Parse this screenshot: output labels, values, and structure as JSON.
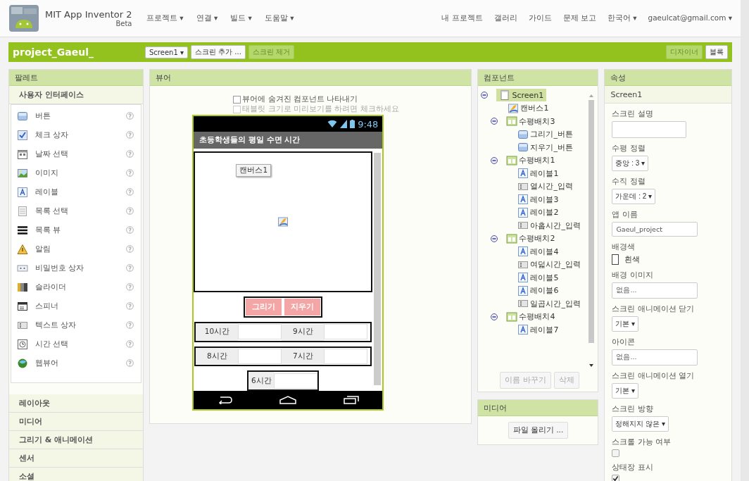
{
  "header": {
    "logo_title": "MIT App Inventor 2",
    "logo_subtitle": "Beta",
    "menus": [
      "프로젝트 ▾",
      "연결 ▾",
      "빌드 ▾",
      "도움말 ▾"
    ],
    "links": [
      "내 프로젝트",
      "갤러리",
      "가이드",
      "문제 보고",
      "한국어 ▾",
      "gaeulcat@gmail.com ▾"
    ]
  },
  "project_bar": {
    "name": "project_Gaeul_",
    "buttons": [
      {
        "label": "Screen1 ▾",
        "disabled": false
      },
      {
        "label": "스크린 추가 ...",
        "disabled": false
      },
      {
        "label": "스크린 제거",
        "disabled": true
      }
    ],
    "mode_buttons": [
      {
        "label": "디자이너",
        "selected": true
      },
      {
        "label": "블록",
        "selected": false
      }
    ]
  },
  "palette": {
    "title": "팔레트",
    "categories": [
      {
        "label": "사용자 인터페이스",
        "items": [
          {
            "kind": "button",
            "label": "버튼"
          },
          {
            "kind": "checkbox",
            "label": "체크 상자"
          },
          {
            "kind": "datepicker",
            "label": "날짜 선택"
          },
          {
            "kind": "image",
            "label": "이미지"
          },
          {
            "kind": "label",
            "label": "레이블"
          },
          {
            "kind": "listpicker",
            "label": "목록 선택"
          },
          {
            "kind": "listview",
            "label": "목록 뷰"
          },
          {
            "kind": "notifier",
            "label": "알림"
          },
          {
            "kind": "password",
            "label": "비밀번호 상자"
          },
          {
            "kind": "slider",
            "label": "슬라이더"
          },
          {
            "kind": "spinner",
            "label": "스피너"
          },
          {
            "kind": "textbox",
            "label": "텍스트 상자"
          },
          {
            "kind": "timepicker",
            "label": "시간 선택"
          },
          {
            "kind": "webviewer",
            "label": "웹뷰어"
          }
        ]
      },
      {
        "label": "레이아웃"
      },
      {
        "label": "미디어"
      },
      {
        "label": "그리기 & 애니메이션"
      },
      {
        "label": "센서"
      },
      {
        "label": "소셜"
      }
    ]
  },
  "viewer": {
    "title": "뷰어",
    "options": [
      {
        "label": "뷰어에 숨겨진 컴포넌트 나타내기",
        "checked": false,
        "disabled": false
      },
      {
        "label": "태블릿 크기로 미리보기를 하려면 체크하세요",
        "checked": false,
        "disabled": true
      }
    ],
    "phone": {
      "time": "9:48",
      "title": "초등학생들의 평일 수면 시간",
      "canvas_label": "캔버스1",
      "buttons": [
        "그리기",
        "지우기"
      ],
      "rows": [
        {
          "fields": [
            {
              "label": "10시간"
            },
            {
              "label": "9시간"
            }
          ]
        },
        {
          "fields": [
            {
              "label": "8시간"
            },
            {
              "label": "7시간"
            }
          ]
        },
        {
          "fields": [
            {
              "label": "6시간"
            }
          ]
        }
      ]
    }
  },
  "components": {
    "title": "컴포넌트",
    "tree": [
      {
        "kind": "screen",
        "label": "Screen1",
        "selected": true,
        "expanded": true,
        "children": [
          {
            "kind": "canvas",
            "label": "캔버스1",
            "selected": false
          },
          {
            "kind": "arrangement",
            "label": "수평배치3",
            "selected": false,
            "expanded": true,
            "children": [
              {
                "kind": "button",
                "label": "그리기_버튼",
                "selected": false
              },
              {
                "kind": "button",
                "label": "지우기_버튼",
                "selected": false
              }
            ]
          },
          {
            "kind": "arrangement",
            "label": "수평배치1",
            "selected": false,
            "expanded": true,
            "children": [
              {
                "kind": "label",
                "label": "레이블1",
                "selected": false
              },
              {
                "kind": "textbox",
                "label": "열시간_입력",
                "selected": false
              },
              {
                "kind": "label",
                "label": "레이블3",
                "selected": false
              },
              {
                "kind": "label",
                "label": "레이블2",
                "selected": false
              },
              {
                "kind": "textbox",
                "label": "아홉시간_입력",
                "selected": false
              }
            ]
          },
          {
            "kind": "arrangement",
            "label": "수평배치2",
            "selected": false,
            "expanded": true,
            "children": [
              {
                "kind": "label",
                "label": "레이블4",
                "selected": false
              },
              {
                "kind": "textbox",
                "label": "여덟시간_입력",
                "selected": false
              },
              {
                "kind": "label",
                "label": "레이블5",
                "selected": false
              },
              {
                "kind": "label",
                "label": "레이블6",
                "selected": false
              },
              {
                "kind": "textbox",
                "label": "일곱시간_입력",
                "selected": false
              }
            ]
          },
          {
            "kind": "arrangement",
            "label": "수평배치4",
            "selected": false,
            "expanded": true,
            "children": [
              {
                "kind": "label",
                "label": "레이블7",
                "selected": false
              }
            ]
          }
        ]
      }
    ],
    "buttons": [
      {
        "label": "이름 바꾸기",
        "disabled": true
      },
      {
        "label": "삭제",
        "disabled": true
      }
    ]
  },
  "media": {
    "title": "미디어",
    "button": "파일 올리기 ..."
  },
  "properties": {
    "title": "속성",
    "component": "Screen1",
    "items": [
      {
        "kind": "textarea",
        "label": "스크린 설명"
      },
      {
        "kind": "select",
        "label": "수평 정렬",
        "value": "중앙 : 3 ▾"
      },
      {
        "kind": "select",
        "label": "수직 정렬",
        "value": "가운데 : 2 ▾"
      },
      {
        "kind": "text",
        "label": "앱 이름",
        "value": "Gaeul_project"
      },
      {
        "kind": "color",
        "label": "배경색",
        "value": "흰색",
        "color": "#ffffff"
      },
      {
        "kind": "text",
        "label": "배경 이미지",
        "value": "없음..."
      },
      {
        "kind": "select",
        "label": "스크린 애니메이션 닫기",
        "value": "기본 ▾"
      },
      {
        "kind": "text",
        "label": "아이콘",
        "value": "없음..."
      },
      {
        "kind": "select",
        "label": "스크린 애니메이션 열기",
        "value": "기본 ▾"
      },
      {
        "kind": "select",
        "label": "스크린 방향",
        "value": "정해지지 않은 ▾"
      },
      {
        "kind": "checkbox",
        "label": "스크롤 가능 여부",
        "checked": false
      },
      {
        "kind": "checkbox",
        "label": "상태장 표시",
        "checked": true
      }
    ]
  }
}
